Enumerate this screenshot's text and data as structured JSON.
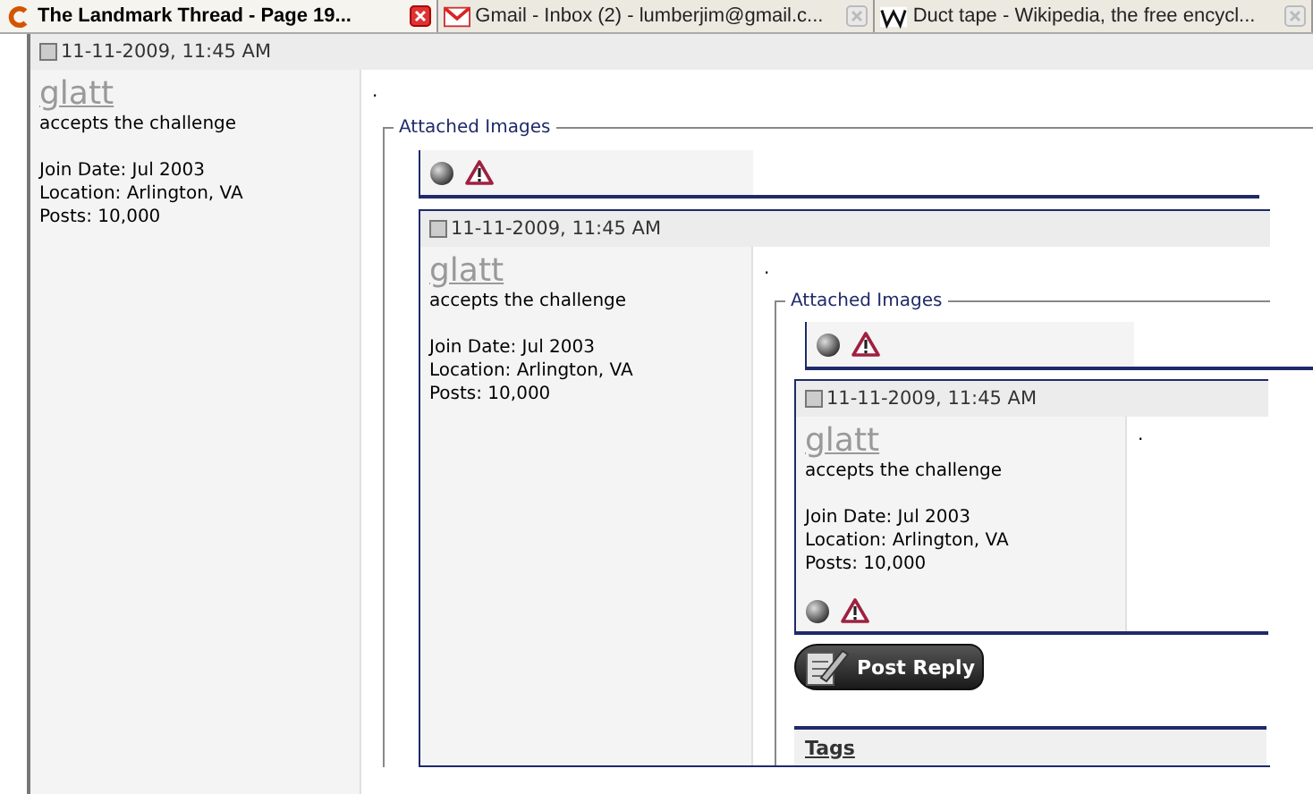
{
  "tabs": [
    {
      "label": "The Landmark Thread - Page 19...",
      "selected": true,
      "kind": "c"
    },
    {
      "label": "Gmail - Inbox (2) - lumberjim@gmail.c...",
      "selected": false,
      "kind": "mail"
    },
    {
      "label": "Duct tape - Wikipedia, the free encycl...",
      "selected": false,
      "kind": "w"
    }
  ],
  "post": {
    "date": "11-11-2009, 11:45 AM",
    "username": "glatt",
    "user_title": "accepts the challenge",
    "details": [
      "Join Date: Jul 2003",
      "Location: Arlington, VA",
      "Posts: 10,000"
    ],
    "body": ".",
    "attached_images": {
      "legend": "Attached Images",
      "post": {
        "date": "11-11-2009, 11:45 AM",
        "username": "glatt",
        "user_title": "accepts the challenge",
        "details": [
          "Join Date: Jul 2003",
          "Location: Arlington, VA",
          "Posts: 10,000"
        ],
        "body": ".",
        "attached_images": {
          "legend": "Attached Images",
          "post": {
            "date": "11-11-2009, 11:45 AM",
            "username": "glatt",
            "user_title": "accepts the challenge",
            "details": [
              "Join Date: Jul 2003",
              "Location: Arlington, VA",
              "Posts: 10,000"
            ],
            "body": "."
          },
          "post_reply": "Post Reply",
          "tags": "Tags"
        }
      }
    }
  }
}
